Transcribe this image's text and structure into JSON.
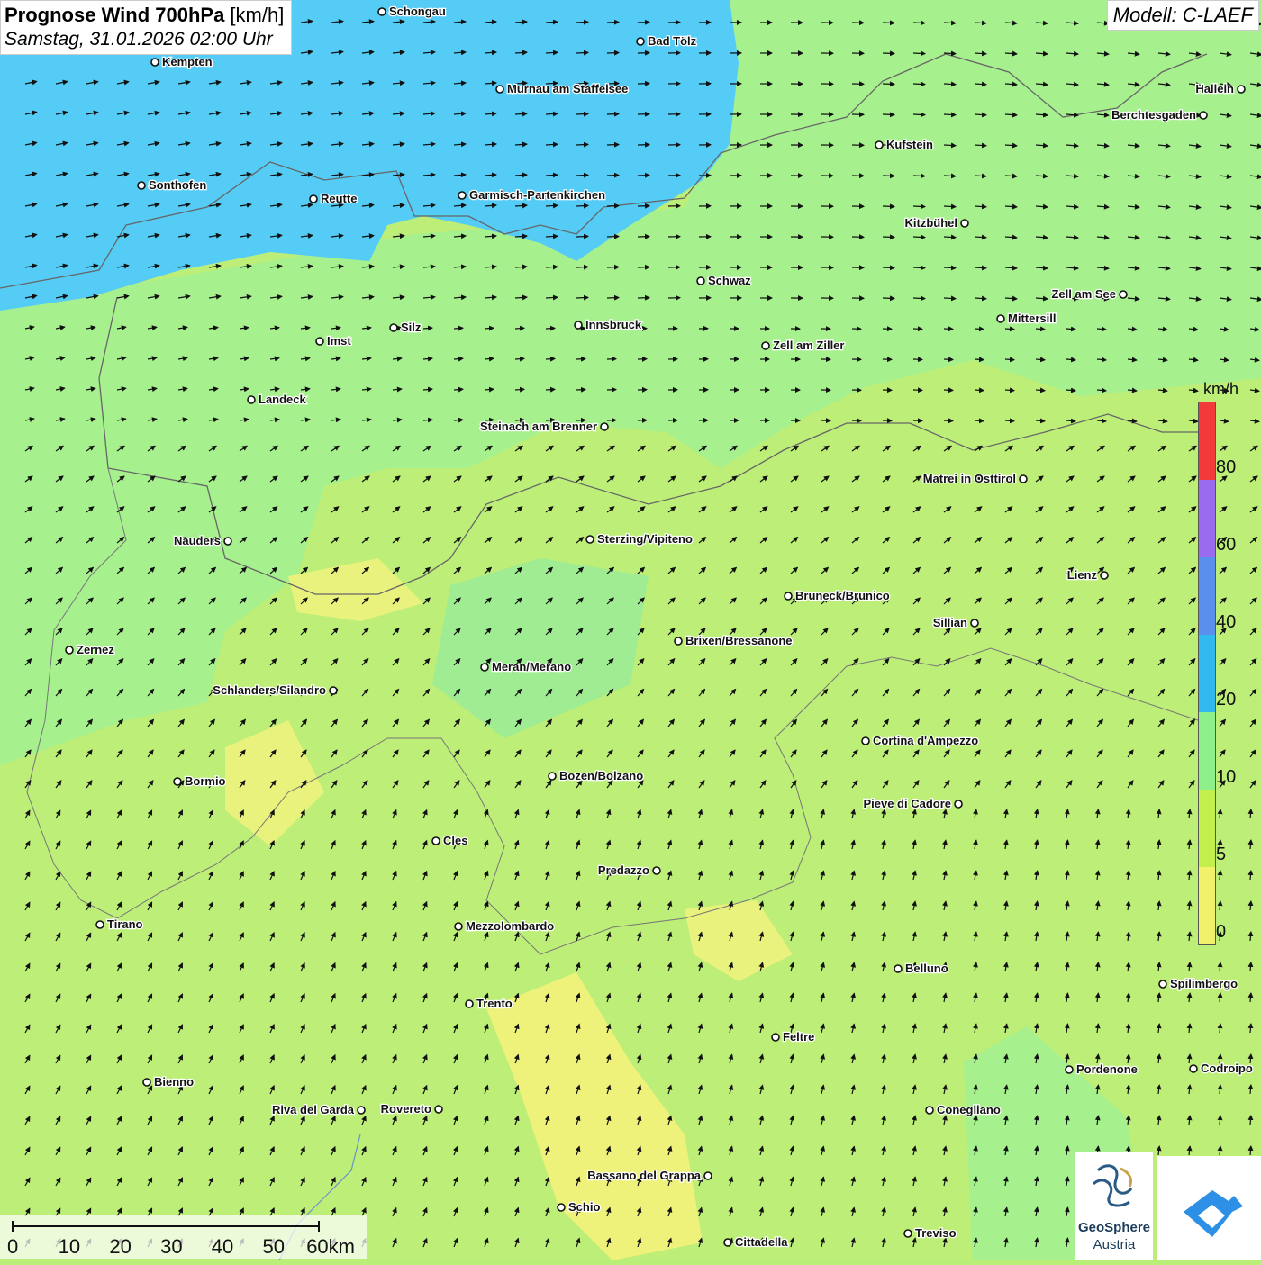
{
  "title": {
    "main_bold": "Prognose Wind 700hPa",
    "main_unit": " [km/h]",
    "date": "Samstag, 31.01.2026 02:00 Uhr"
  },
  "model": "Modell: C-LAEF",
  "legend": {
    "unit": "km/h",
    "labels": [
      "80",
      "60",
      "40",
      "20",
      "10",
      "5",
      "0"
    ],
    "colors": [
      "#f23a3a",
      "#9a6bef",
      "#5a8fee",
      "#2fb9ef",
      "#8df08a",
      "#c4f04d",
      "#f2f26a"
    ]
  },
  "scalebar": {
    "labels": [
      "0",
      "10",
      "20",
      "30",
      "40",
      "50",
      "60km"
    ]
  },
  "logo": {
    "line1": "GeoSphere",
    "line2": "Austria"
  },
  "cities": [
    {
      "name": "Schongau"
    },
    {
      "name": "Bad Tölz"
    },
    {
      "name": "Kempten"
    },
    {
      "name": "Murnau am Staffelsee"
    },
    {
      "name": "Hallein"
    },
    {
      "name": "Berchtesgaden"
    },
    {
      "name": "Kufstein"
    },
    {
      "name": "Sonthofen"
    },
    {
      "name": "Reutte"
    },
    {
      "name": "Garmisch-Partenkirchen"
    },
    {
      "name": "Kitzbühel"
    },
    {
      "name": "Schwaz"
    },
    {
      "name": "Zell am See"
    },
    {
      "name": "Mittersill"
    },
    {
      "name": "Silz"
    },
    {
      "name": "Innsbruck"
    },
    {
      "name": "Imst"
    },
    {
      "name": "Zell am Ziller"
    },
    {
      "name": "Landeck"
    },
    {
      "name": "Steinach am Brenner"
    },
    {
      "name": "Matrei in Osttirol"
    },
    {
      "name": "Nauders"
    },
    {
      "name": "Sterzing/Vipiteno"
    },
    {
      "name": "Lienz"
    },
    {
      "name": "Bruneck/Brunico"
    },
    {
      "name": "Sillian"
    },
    {
      "name": "Zernez"
    },
    {
      "name": "Brixen/Bressanone"
    },
    {
      "name": "Meran/Merano"
    },
    {
      "name": "Schlanders/Silandro"
    },
    {
      "name": "Cortina d'Ampezzo"
    },
    {
      "name": "Bozen/Bolzano"
    },
    {
      "name": "Bormio"
    },
    {
      "name": "Pieve di Cadore"
    },
    {
      "name": "Cles"
    },
    {
      "name": "Predazzo"
    },
    {
      "name": "Tirano"
    },
    {
      "name": "Mezzolombardo"
    },
    {
      "name": "Belluno"
    },
    {
      "name": "Spilimbergo"
    },
    {
      "name": "Trento"
    },
    {
      "name": "Feltre"
    },
    {
      "name": "Pordenone"
    },
    {
      "name": "Codroipo"
    },
    {
      "name": "Bienno"
    },
    {
      "name": "Riva del Garda"
    },
    {
      "name": "Rovereto"
    },
    {
      "name": "Conegliano"
    },
    {
      "name": "Bassano del Grappa"
    },
    {
      "name": "Schio"
    },
    {
      "name": "Treviso"
    },
    {
      "name": "Cittadella"
    }
  ]
}
